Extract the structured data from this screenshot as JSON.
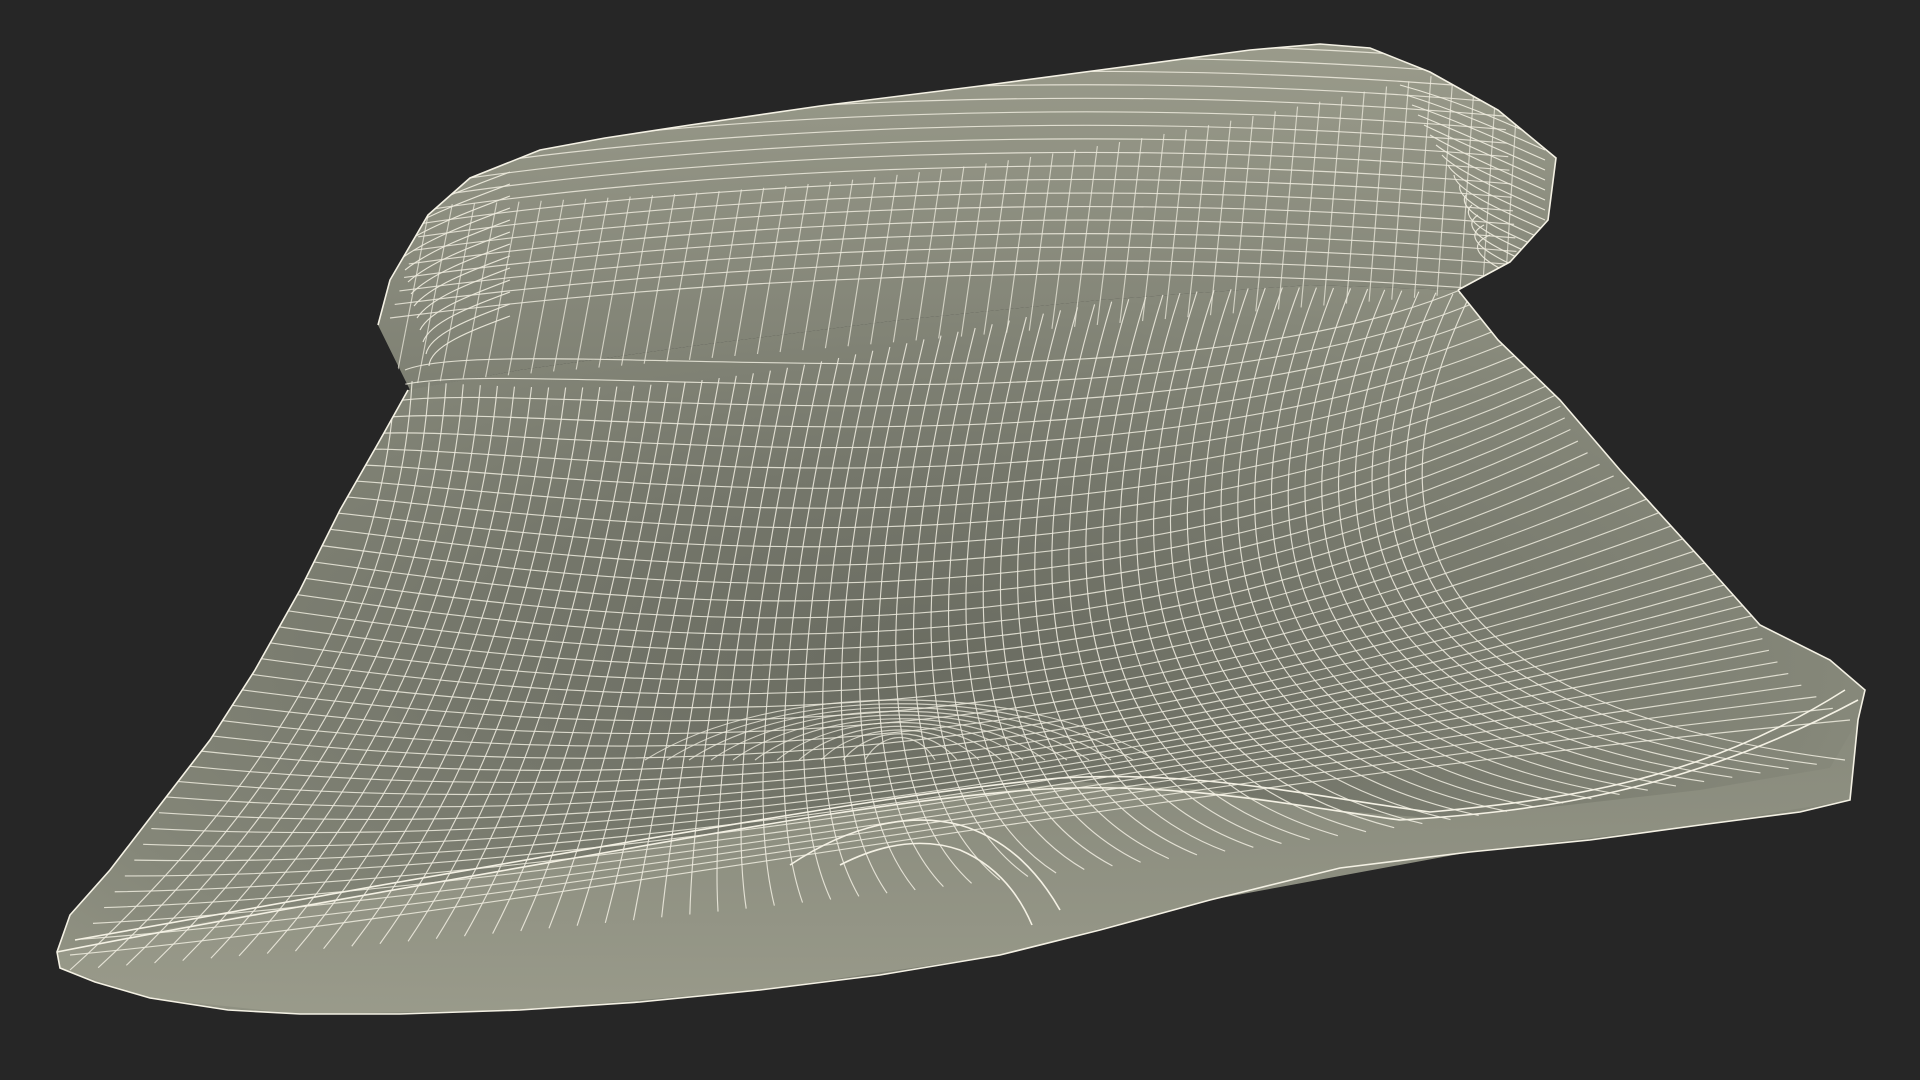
{
  "scene": {
    "subject": "wireframe-pillow-render",
    "colors": {
      "background": "#262626",
      "surface_light": "#8d8f80",
      "surface_mid": "#7b7d70",
      "surface_dark": "#66685d",
      "wire": "#f4f1e4",
      "wire_dim": "#d9d6c8"
    }
  }
}
